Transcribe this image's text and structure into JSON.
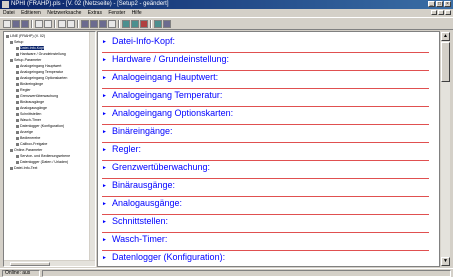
{
  "window": {
    "title": "NPHI (FRAHP).pls - [V. 02 (Netzseite) - [Setup2 - geändert]",
    "menu": [
      "Datei",
      "Editieren",
      "Netzwerksache",
      "Extras",
      "Fenster",
      "Hilfe"
    ]
  },
  "tree": {
    "nodes": [
      {
        "label": "LINE (FRAHP) (V. 02)",
        "depth": 0,
        "selected": false
      },
      {
        "label": "Setup",
        "depth": 1,
        "selected": false
      },
      {
        "label": "Datei-Info-Kopf",
        "depth": 2,
        "selected": true
      },
      {
        "label": "Hardware / Grundeinstellung",
        "depth": 2,
        "selected": false
      },
      {
        "label": "Setup-Parameter",
        "depth": 1,
        "selected": false
      },
      {
        "label": "Analogeingang Hauptwert",
        "depth": 2,
        "selected": false
      },
      {
        "label": "Analogeingang Temperatur",
        "depth": 2,
        "selected": false
      },
      {
        "label": "Analogeingang Optionskarten",
        "depth": 2,
        "selected": false
      },
      {
        "label": "Binäreingänge",
        "depth": 2,
        "selected": false
      },
      {
        "label": "Regler",
        "depth": 2,
        "selected": false
      },
      {
        "label": "Grenzwertüberwachung",
        "depth": 2,
        "selected": false
      },
      {
        "label": "Binärausgänge",
        "depth": 2,
        "selected": false
      },
      {
        "label": "Analogausgänge",
        "depth": 2,
        "selected": false
      },
      {
        "label": "Schnittstellen",
        "depth": 2,
        "selected": false
      },
      {
        "label": "Wasch-Timer",
        "depth": 2,
        "selected": false
      },
      {
        "label": "Datenlogger (Konfiguration)",
        "depth": 2,
        "selected": false
      },
      {
        "label": "Anzeige",
        "depth": 2,
        "selected": false
      },
      {
        "label": "Bedienerebe",
        "depth": 2,
        "selected": false
      },
      {
        "label": "Callbox-Freigabe",
        "depth": 2,
        "selected": false
      },
      {
        "label": "Online-Parameter",
        "depth": 1,
        "selected": false
      },
      {
        "label": "Service- und Bedienungsebene",
        "depth": 2,
        "selected": false
      },
      {
        "label": "Datenlogger (Daten / Urladen)",
        "depth": 2,
        "selected": false
      },
      {
        "label": "Datei-Info-Text",
        "depth": 1,
        "selected": false
      }
    ]
  },
  "sections": [
    "Datei-Info-Kopf:",
    "Hardware / Grundeinstellung:",
    "Analogeingang Hauptwert:",
    "Analogeingang Temperatur:",
    "Analogeingang Optionskarten:",
    "Binäreingänge:",
    "Regler:",
    "Grenzwertüberwachung:",
    "Binärausgänge:",
    "Analogausgänge:",
    "Schnittstellen:",
    "Wasch-Timer:",
    "Datenlogger (Konfiguration):"
  ],
  "status": {
    "left": "Online: aus",
    "right": ""
  },
  "colors": {
    "section_text": "#0000ff",
    "section_rule": "#e05050",
    "title_bar": "#0a246a"
  }
}
